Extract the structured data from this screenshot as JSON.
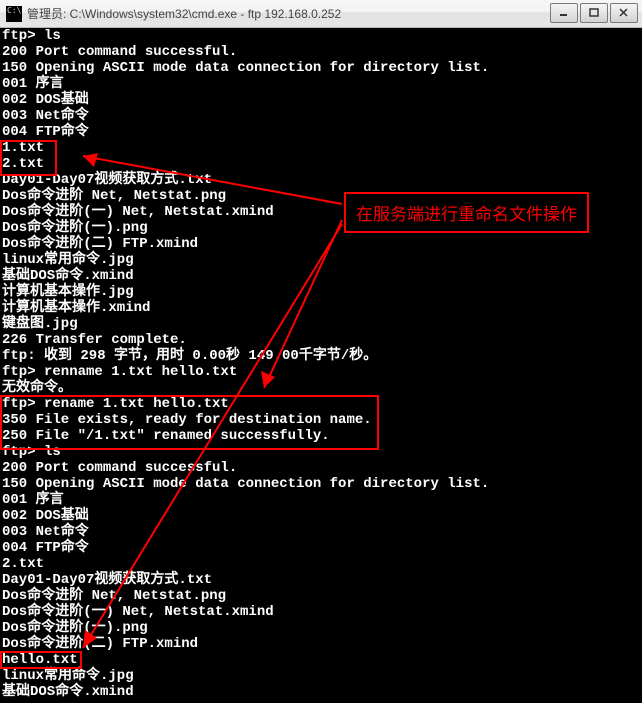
{
  "window": {
    "title": "管理员: C:\\Windows\\system32\\cmd.exe - ftp  192.168.0.252",
    "icon": "cmd-icon"
  },
  "annotation": {
    "label": "在服务端进行重命名文件操作"
  },
  "lines": [
    "ftp> ls",
    "200 Port command successful.",
    "150 Opening ASCII mode data connection for directory list.",
    "001 序言",
    "002 DOS基础",
    "003 Net命令",
    "004 FTP命令",
    "1.txt",
    "2.txt",
    "Day01-Day07视频获取方式.txt",
    "Dos命令进阶 Net, Netstat.png",
    "Dos命令进阶(一) Net, Netstat.xmind",
    "Dos命令进阶(一).png",
    "Dos命令进阶(二) FTP.xmind",
    "linux常用命令.jpg",
    "基础DOS命令.xmind",
    "计算机基本操作.jpg",
    "计算机基本操作.xmind",
    "键盘图.jpg",
    "226 Transfer complete.",
    "ftp: 收到 298 字节，用时 0.00秒 149.00千字节/秒。",
    "ftp> renname 1.txt hello.txt",
    "无效命令。",
    "ftp> rename 1.txt hello.txt",
    "350 File exists, ready for destination name.",
    "250 File \"/1.txt\" renamed successfully.",
    "ftp> ls",
    "200 Port command successful.",
    "150 Opening ASCII mode data connection for directory list.",
    "001 序言",
    "002 DOS基础",
    "003 Net命令",
    "004 FTP命令",
    "2.txt",
    "Day01-Day07视频获取方式.txt",
    "Dos命令进阶 Net, Netstat.png",
    "Dos命令进阶(一) Net, Netstat.xmind",
    "Dos命令进阶(一).png",
    "Dos命令进阶(二) FTP.xmind",
    "hello.txt",
    "linux常用命令.jpg",
    "基础DOS命令.xmind"
  ]
}
